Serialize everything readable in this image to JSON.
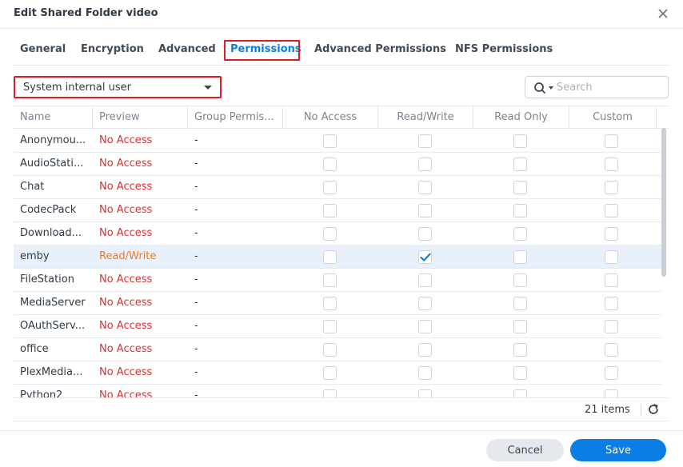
{
  "window": {
    "title": "Edit Shared Folder video"
  },
  "tabs": [
    {
      "label": "General"
    },
    {
      "label": "Encryption"
    },
    {
      "label": "Advanced"
    },
    {
      "label": "Permissions",
      "active": true
    },
    {
      "label": "Advanced Permissions"
    },
    {
      "label": "NFS Permissions"
    }
  ],
  "user_type": {
    "selected": "System internal user"
  },
  "search": {
    "placeholder": "Search",
    "value": ""
  },
  "table": {
    "columns": [
      "Name",
      "Preview",
      "Group Permis...",
      "No Access",
      "Read/Write",
      "Read Only",
      "Custom"
    ],
    "rows": [
      {
        "name": "Anonymou...",
        "preview": "No Access",
        "group": "-",
        "no_access": false,
        "read_write": false,
        "read_only": false,
        "custom": false
      },
      {
        "name": "AudioStati...",
        "preview": "No Access",
        "group": "-",
        "no_access": false,
        "read_write": false,
        "read_only": false,
        "custom": false
      },
      {
        "name": "Chat",
        "preview": "No Access",
        "group": "-",
        "no_access": false,
        "read_write": false,
        "read_only": false,
        "custom": false
      },
      {
        "name": "CodecPack",
        "preview": "No Access",
        "group": "-",
        "no_access": false,
        "read_write": false,
        "read_only": false,
        "custom": false
      },
      {
        "name": "Download...",
        "preview": "No Access",
        "group": "-",
        "no_access": false,
        "read_write": false,
        "read_only": false,
        "custom": false
      },
      {
        "name": "emby",
        "preview": "Read/Write",
        "group": "-",
        "no_access": false,
        "read_write": true,
        "read_only": false,
        "custom": false,
        "selected": true
      },
      {
        "name": "FileStation",
        "preview": "No Access",
        "group": "-",
        "no_access": false,
        "read_write": false,
        "read_only": false,
        "custom": false
      },
      {
        "name": "MediaServer",
        "preview": "No Access",
        "group": "-",
        "no_access": false,
        "read_write": false,
        "read_only": false,
        "custom": false
      },
      {
        "name": "OAuthServ...",
        "preview": "No Access",
        "group": "-",
        "no_access": false,
        "read_write": false,
        "read_only": false,
        "custom": false
      },
      {
        "name": "office",
        "preview": "No Access",
        "group": "-",
        "no_access": false,
        "read_write": false,
        "read_only": false,
        "custom": false
      },
      {
        "name": "PlexMedia...",
        "preview": "No Access",
        "group": "-",
        "no_access": false,
        "read_write": false,
        "read_only": false,
        "custom": false
      },
      {
        "name": "Python2",
        "preview": "No Access",
        "group": "-",
        "no_access": false,
        "read_write": false,
        "read_only": false,
        "custom": false
      }
    ]
  },
  "status": {
    "item_count": "21 items"
  },
  "buttons": {
    "cancel": "Cancel",
    "save": "Save"
  },
  "colors": {
    "accent": "#0a7ee4",
    "no_access": "#e02e2e",
    "read_write": "#f07a23",
    "highlight_outline": "#e01b22",
    "selected_row": "#e8f1fb"
  },
  "icons": {
    "close": "close-icon",
    "search": "search-icon",
    "refresh": "refresh-icon",
    "dropdown": "chevron-down-icon"
  }
}
